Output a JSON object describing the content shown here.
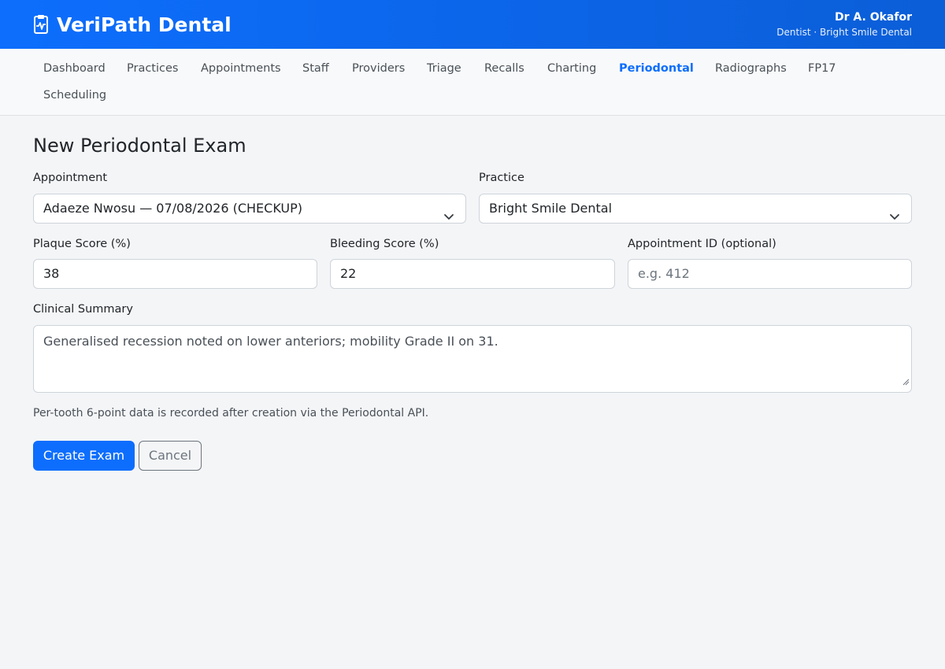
{
  "header": {
    "app_name": "VeriPath Dental",
    "user_name": "Dr A. Okafor",
    "user_role": "Dentist · Bright Smile Dental"
  },
  "nav": {
    "items": [
      {
        "label": "Dashboard"
      },
      {
        "label": "Practices"
      },
      {
        "label": "Appointments"
      },
      {
        "label": "Staff"
      },
      {
        "label": "Providers"
      },
      {
        "label": "Triage"
      },
      {
        "label": "Recalls"
      },
      {
        "label": "Charting"
      },
      {
        "label": "Periodontal",
        "active": true
      },
      {
        "label": "Radiographs"
      },
      {
        "label": "FP17"
      },
      {
        "label": "Scheduling"
      }
    ]
  },
  "form": {
    "title": "New Periodontal Exam",
    "appointment_label": "Appointment",
    "appointment_value": "Adaeze Nwosu — 07/08/2026 (CHECKUP)",
    "practice_label": "Practice",
    "practice_value": "Bright Smile Dental",
    "plaque_label": "Plaque Score (%)",
    "plaque_value": "38",
    "bleeding_label": "Bleeding Score (%)",
    "bleeding_value": "22",
    "appointment_id_label": "Appointment ID (optional)",
    "appointment_id_placeholder": "e.g. 412",
    "summary_label": "Clinical Summary",
    "summary_value": "Generalised recession noted on lower anteriors; mobility Grade II on 31.",
    "help_text": "Per-tooth 6-point data is recorded after creation via the Periodontal API.",
    "create_label": "Create Exam",
    "cancel_label": "Cancel"
  },
  "colors": {
    "primary": "#0d6efd",
    "header_bg": "#0d6efd",
    "page_bg": "#f4f5f7"
  },
  "icons": {
    "brand": "clipboard-pulse-icon",
    "select": "chevron-down-icon"
  }
}
